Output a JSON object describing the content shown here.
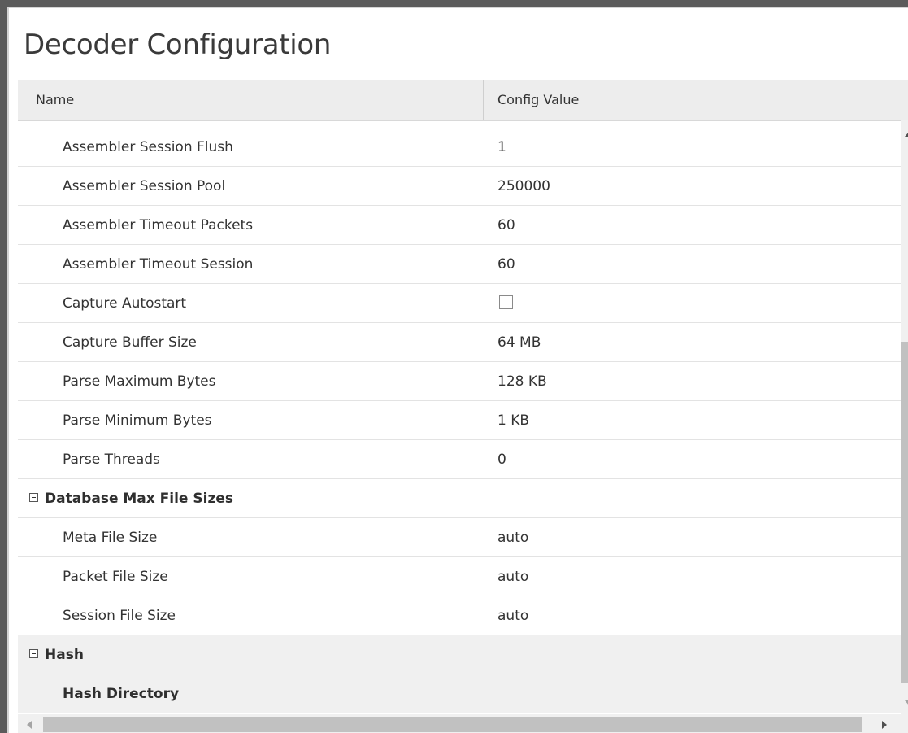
{
  "page": {
    "title": "Decoder Configuration"
  },
  "table": {
    "columns": {
      "name": "Name",
      "value": "Config Value"
    },
    "rows": [
      {
        "name": "Assembler Session Flush",
        "value": "1"
      },
      {
        "name": "Assembler Session Pool",
        "value": "250000"
      },
      {
        "name": "Assembler Timeout Packets",
        "value": "60"
      },
      {
        "name": "Assembler Timeout Session",
        "value": "60"
      },
      {
        "name": "Capture Autostart",
        "value": "",
        "checkbox": true,
        "checked": false
      },
      {
        "name": "Capture Buffer Size",
        "value": "64 MB"
      },
      {
        "name": "Parse Maximum Bytes",
        "value": "128 KB"
      },
      {
        "name": "Parse Minimum Bytes",
        "value": "1 KB"
      },
      {
        "name": "Parse Threads",
        "value": "0"
      },
      {
        "name": "Database Max File Sizes",
        "group": true,
        "expanded": true
      },
      {
        "name": "Meta File Size",
        "value": "auto"
      },
      {
        "name": "Packet File Size",
        "value": "auto"
      },
      {
        "name": "Session File Size",
        "value": "auto"
      },
      {
        "name": "Hash",
        "group": true,
        "expanded": true,
        "shaded": true
      },
      {
        "name": "Hash Directory",
        "value": "",
        "bold": true,
        "shaded": true
      }
    ]
  }
}
